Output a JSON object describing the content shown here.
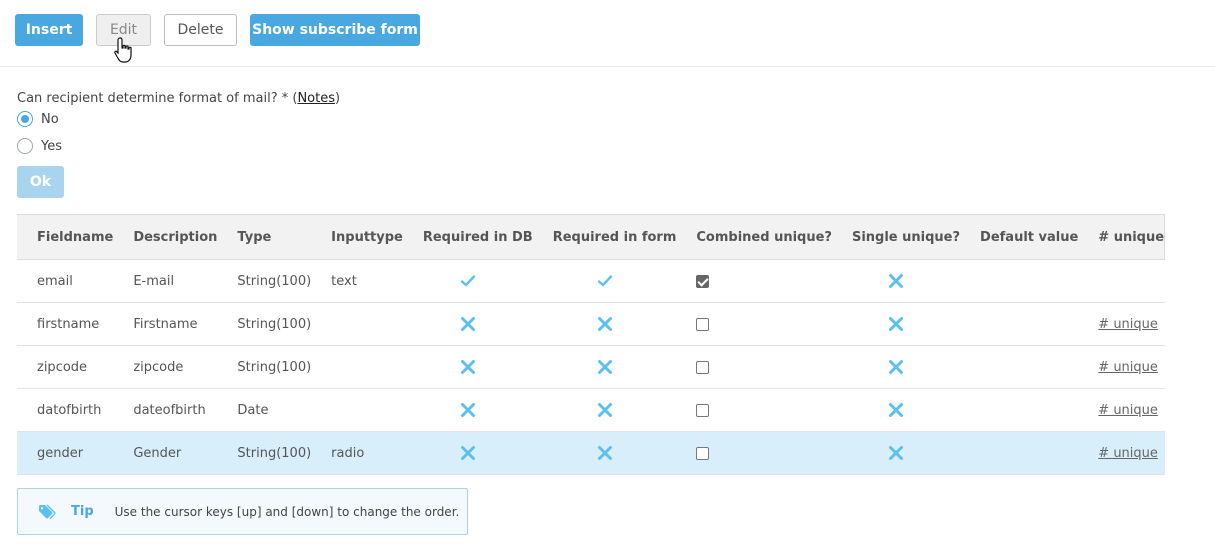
{
  "toolbar": {
    "insert_label": "Insert",
    "edit_label": "Edit",
    "delete_label": "Delete",
    "subscribe_label": "Show subscribe form"
  },
  "mail_format": {
    "question": "Can recipient determine format of mail? * (",
    "notes_link": "Notes",
    "close_paren": ")",
    "options": [
      {
        "label": "No",
        "checked": true
      },
      {
        "label": "Yes",
        "checked": false
      }
    ],
    "ok_label": "Ok"
  },
  "table": {
    "headers": [
      "Fieldname",
      "Description",
      "Type",
      "Inputtype",
      "Required in DB",
      "Required in form",
      "Combined unique?",
      "Single unique?",
      "Default value",
      "# unique"
    ],
    "rows": [
      {
        "fieldname": "email",
        "description": "E-mail",
        "type": "String(100)",
        "inputtype": "text",
        "required_db": "check-icon",
        "required_form": "check-icon",
        "combined_unique": true,
        "single_unique": "cross-icon",
        "default_value": "",
        "unique_link": ""
      },
      {
        "fieldname": "firstname",
        "description": "Firstname",
        "type": "String(100)",
        "inputtype": "",
        "required_db": "cross-icon",
        "required_form": "cross-icon",
        "combined_unique": false,
        "single_unique": "cross-icon",
        "default_value": "",
        "unique_link": "# unique"
      },
      {
        "fieldname": "zipcode",
        "description": "zipcode",
        "type": "String(100)",
        "inputtype": "",
        "required_db": "cross-icon",
        "required_form": "cross-icon",
        "combined_unique": false,
        "single_unique": "cross-icon",
        "default_value": "",
        "unique_link": "# unique"
      },
      {
        "fieldname": "datofbirth",
        "description": "dateofbirth",
        "type": "Date",
        "inputtype": "",
        "required_db": "cross-icon",
        "required_form": "cross-icon",
        "combined_unique": false,
        "single_unique": "cross-icon",
        "default_value": "",
        "unique_link": "# unique"
      },
      {
        "fieldname": "gender",
        "description": "Gender",
        "type": "String(100)",
        "inputtype": "radio",
        "required_db": "cross-icon",
        "required_form": "cross-icon",
        "combined_unique": false,
        "single_unique": "cross-icon",
        "default_value": "",
        "unique_link": "# unique",
        "selected": true
      }
    ]
  },
  "tip": {
    "label": "Tip",
    "text": "Use the cursor keys [up] and [down] to change the order.",
    "icon": "tag-icon"
  },
  "colors": {
    "accent": "#4aa8e0",
    "icon_blue": "#5bc0ef",
    "selected_row": "#d9eefb"
  }
}
